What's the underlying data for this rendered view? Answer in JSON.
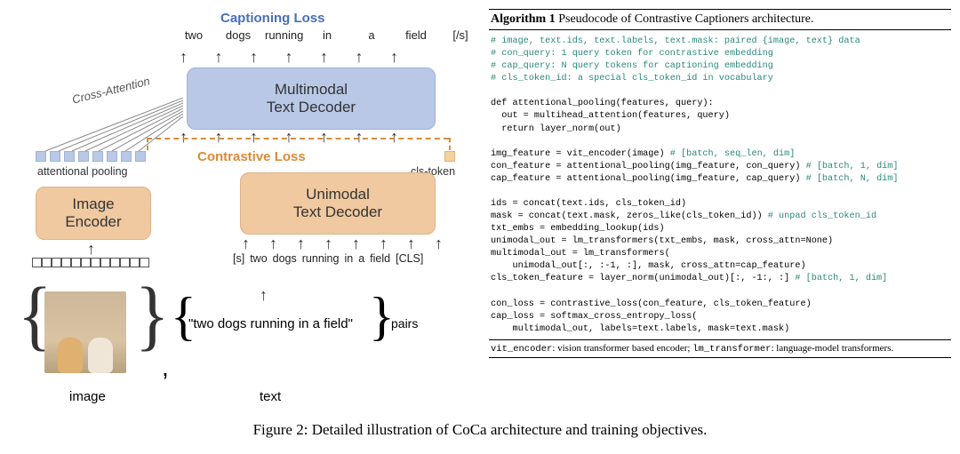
{
  "figure": {
    "caption": "Figure 2: Detailed illustration of CoCa architecture and training objectives.",
    "left": {
      "labels": {
        "captioning_loss": "Captioning Loss",
        "contrastive_loss": "Contrastive Loss",
        "cross_attention": "Cross-Attention",
        "attentional_pooling": "attentional pooling",
        "cls_token": "cls-token",
        "image": "image",
        "text": "text",
        "pairs": "pairs"
      },
      "modules": {
        "image_encoder": "Image\nEncoder",
        "unimodal_decoder": "Unimodal\nText Decoder",
        "multimodal_decoder": "Multimodal\nText Decoder"
      },
      "tokens_out": [
        "two",
        "dogs",
        "running",
        "in",
        "a",
        "field",
        "[/s]"
      ],
      "tokens_in": [
        "[s]",
        "two",
        "dogs",
        "running",
        "in",
        "a",
        "field",
        "[CLS]"
      ],
      "caption_example": "\"two dogs running in a field\""
    },
    "right": {
      "title_prefix": "Algorithm 1",
      "title_rest": "Pseudocode of Contrastive Captioners architecture.",
      "footnote_parts": {
        "vit": "vit_encoder",
        "vit_desc": ": vision transformer based encoder; ",
        "lm": "lm_transformer",
        "lm_desc": ": language-model transformers."
      },
      "code": {
        "c1": "# image, text.ids, text.labels, text.mask: paired {image, text} data",
        "c2": "# con_query: 1 query token for contrastive embedding",
        "c3": "# cap_query: N query tokens for captioning embedding",
        "c4": "# cls_token_id: a special cls_token_id in vocabulary",
        "l5": "",
        "l6": "def attentional_pooling(features, query):",
        "l7": "  out = multihead_attention(features, query)",
        "l8": "  return layer_norm(out)",
        "l9": "",
        "l10a": "img_feature = vit_encoder(image) ",
        "l10b": "# [batch, seq_len, dim]",
        "l11a": "con_feature = attentional_pooling(img_feature, con_query) ",
        "l11b": "# [batch, 1, dim]",
        "l12a": "cap_feature = attentional_pooling(img_feature, cap_query) ",
        "l12b": "# [batch, N, dim]",
        "l13": "",
        "l14": "ids = concat(text.ids, cls_token_id)",
        "l15a": "mask = concat(text.mask, zeros_like(cls_token_id)) ",
        "l15b": "# unpad cls_token_id",
        "l16": "txt_embs = embedding_lookup(ids)",
        "l17": "unimodal_out = lm_transformers(txt_embs, mask, cross_attn=None)",
        "l18": "multimodal_out = lm_transformers(",
        "l19": "    unimodal_out[:, :-1, :], mask, cross_attn=cap_feature)",
        "l20a": "cls_token_feature = layer_norm(unimodal_out)[:, -1:, :] ",
        "l20b": "# [batch, 1, dim]",
        "l21": "",
        "l22": "con_loss = contrastive_loss(con_feature, cls_token_feature)",
        "l23": "cap_loss = softmax_cross_entropy_loss(",
        "l24": "    multimodal_out, labels=text.labels, mask=text.mask)"
      }
    }
  }
}
